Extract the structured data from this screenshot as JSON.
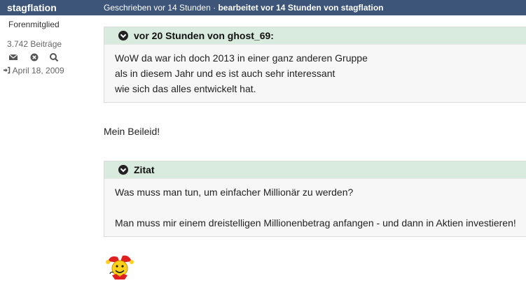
{
  "post": {
    "username": "stagflation",
    "meta_prefix": "Geschrieben vor 14 Stunden · ",
    "meta_edited": "bearbeitet vor 14 Stunden von stagflation"
  },
  "user": {
    "title": "Forenmitglied",
    "post_count": "3.742 Beiträge",
    "join_date": "April 18, 2009",
    "actions": [
      "envelope-icon",
      "ignore-icon",
      "search-icon"
    ]
  },
  "quotes": [
    {
      "title": "vor 20 Stunden von ghost_69:",
      "lines": [
        "WoW da war ich doch 2013 in einer ganz anderen Gruppe",
        "als in diesem Jahr und es ist auch sehr interessant",
        "wie sich das alles entwickelt hat."
      ]
    },
    {
      "title": "Zitat",
      "lines": [
        "Was muss man tun, um einfacher Millionär zu werden?",
        "",
        "Man muss mir einem dreistelligen Millionenbetrag anfangen - und dann in Aktien investieren!"
      ]
    }
  ],
  "reply_text": "Mein Beileid!",
  "colors": {
    "header_bg": "#3d5578",
    "quote_head_bg": "#d9eadf"
  }
}
